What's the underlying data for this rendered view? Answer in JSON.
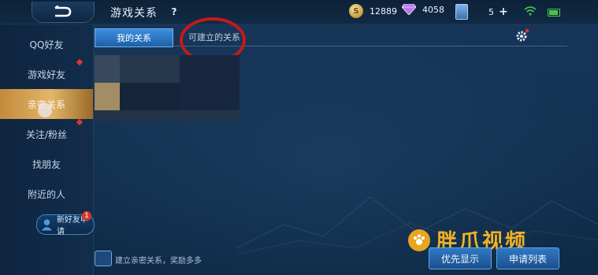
{
  "header": {
    "title": "游戏关系",
    "help_label": "?",
    "gold": "12889",
    "diamonds": "4058",
    "cards": "5",
    "plus_label": "+"
  },
  "sidebar": {
    "items": [
      {
        "label": "QQ好友"
      },
      {
        "label": "游戏好友"
      },
      {
        "label": "亲密关系"
      },
      {
        "label": "关注/粉丝"
      },
      {
        "label": "找朋友"
      },
      {
        "label": "附近的人"
      }
    ],
    "active_index": 2,
    "new_friend_label": "新好友申请",
    "new_friend_badge": "1"
  },
  "tabs": [
    {
      "label": "我的关系",
      "active": true
    },
    {
      "label": "可建立的关系",
      "active": false
    }
  ],
  "bottom": {
    "hint_text": "建立亲密关系，奖励多多",
    "priority_button": "优先显示",
    "request_list_button": "申请列表"
  },
  "watermark": {
    "text": "胖爪视频"
  },
  "colors": {
    "accent": "#2f79c3",
    "active_sidebar": "#e3b66a",
    "highlight_circle": "#c41a1a",
    "watermark": "#f2b024"
  }
}
